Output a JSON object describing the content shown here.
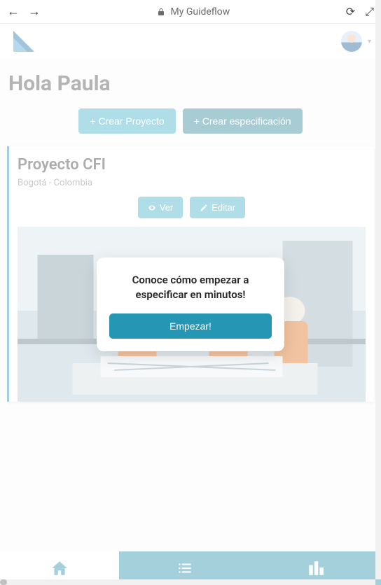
{
  "browser": {
    "title": "My Guideflow"
  },
  "greeting": "Hola Paula",
  "actions": {
    "create_project": "+ Crear Proyecto",
    "create_spec": "+ Crear especificación"
  },
  "project": {
    "title": "Proyecto CFI",
    "location": "Bogotá - Colombia",
    "view_label": "Ver",
    "edit_label": "Editar"
  },
  "modal": {
    "text": "Conoce cómo empezar a especificar en minutos!",
    "button": "Empezar!"
  }
}
